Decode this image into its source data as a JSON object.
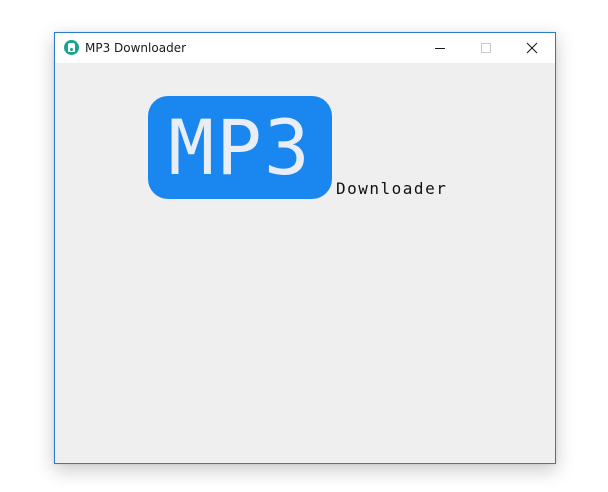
{
  "window": {
    "title": "MP3 Downloader",
    "icon": "app-icon",
    "controls": {
      "minimize_icon": "minimize-icon",
      "maximize_icon": "maximize-icon",
      "close_icon": "close-icon"
    }
  },
  "logo": {
    "badge_text": "MP3",
    "subtitle": "Downloader",
    "badge_color": "#1a86f0",
    "badge_text_color": "#e9eef6"
  },
  "colors": {
    "client_background": "#efefef",
    "titlebar_background": "#ffffff",
    "window_border": "#2b7bcf",
    "app_icon": "#18a58c"
  }
}
